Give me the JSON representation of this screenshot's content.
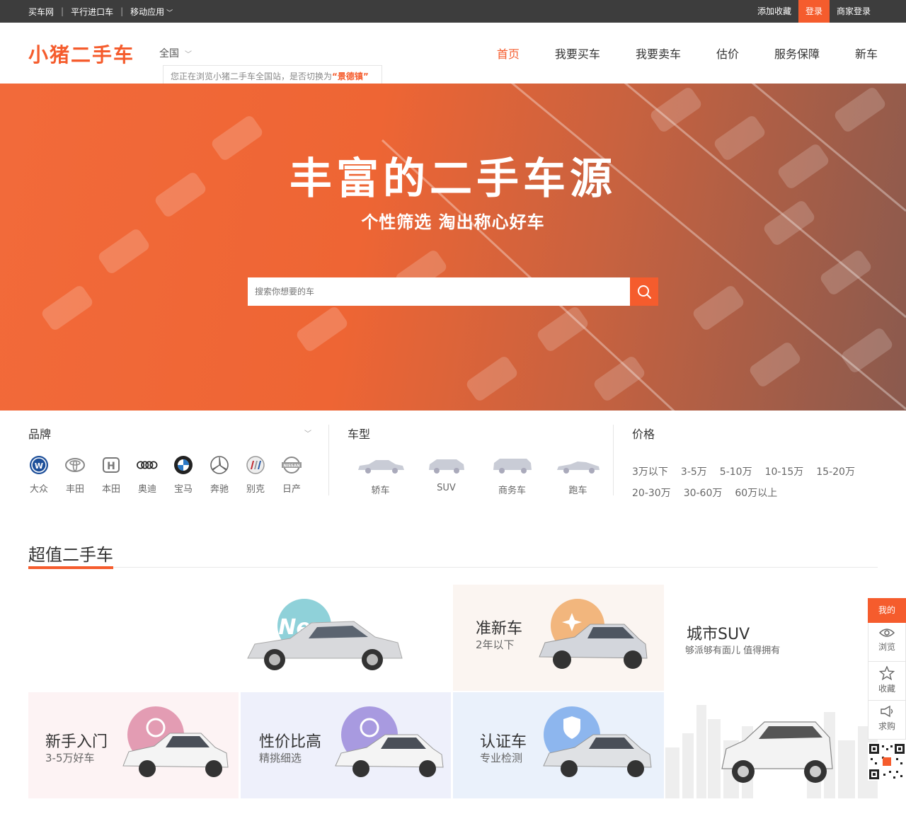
{
  "topbar": {
    "links": [
      "买车网",
      "平行进口车",
      "移动应用"
    ],
    "right": [
      "添加收藏",
      "登录",
      "商家登录"
    ]
  },
  "header": {
    "logo": "小猪二手车",
    "city": "全国",
    "city_tip_prefix": "您正在浏览小猪二手车全国站，是否切换为",
    "city_tip_target": "“景德镇”",
    "nav": [
      "首页",
      "我要买车",
      "我要卖车",
      "估价",
      "服务保障",
      "新车"
    ]
  },
  "hero": {
    "title": "丰富的二手车源",
    "subtitle": "个性筛选 淘出称心好车",
    "search_placeholder": "搜索你想要的车"
  },
  "filter": {
    "brand_heading": "品牌",
    "brands": [
      "大众",
      "丰田",
      "本田",
      "奥迪",
      "宝马",
      "奔驰",
      "别克",
      "日产"
    ],
    "type_heading": "车型",
    "types": [
      "轿车",
      "SUV",
      "商务车",
      "跑车"
    ],
    "price_heading": "价格",
    "prices": [
      "3万以下",
      "3-5万",
      "5-10万",
      "10-15万",
      "15-20万",
      "20-30万",
      "30-60万",
      "60万以上"
    ]
  },
  "section": {
    "title": "超值二手车",
    "tiles": {
      "new_badge": "New",
      "near_new": {
        "title": "准新车",
        "sub": "2年以下"
      },
      "city_suv": {
        "title": "城市SUV",
        "sub": "够派够有面儿 值得拥有"
      },
      "beginner": {
        "title": "新手入门",
        "sub": "3-5万好车"
      },
      "value": {
        "title": "性价比高",
        "sub": "精挑细选"
      },
      "certified": {
        "title": "认证车",
        "sub": "专业检测"
      }
    }
  },
  "side": {
    "mine": "我的",
    "items": [
      "浏览",
      "收藏",
      "求购"
    ]
  },
  "colors": {
    "accent": "#f55c2d",
    "topbar": "#3d3d3d"
  }
}
